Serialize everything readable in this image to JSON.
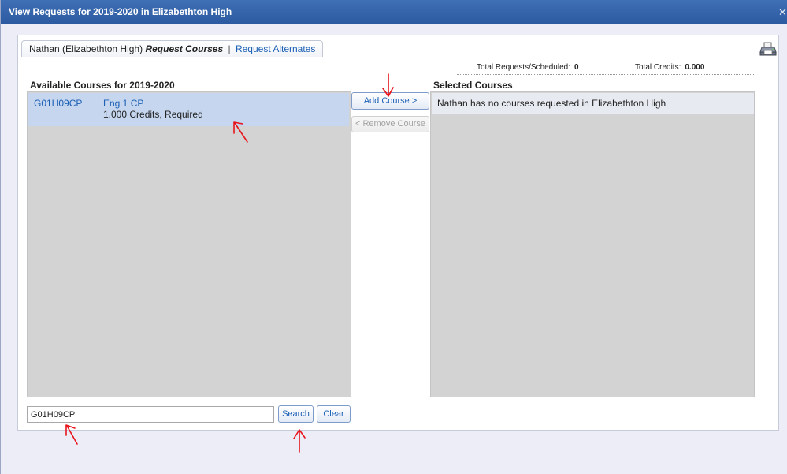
{
  "window": {
    "title": "View Requests for 2019-2020 in Elizabethton High",
    "close_glyph": "✕"
  },
  "tabs": {
    "student": "Nathan (Elizabethton High)",
    "active": "Request Courses",
    "separator": "|",
    "alternates": "Request Alternates"
  },
  "totals": {
    "requests_label": "Total Requests/Scheduled:",
    "requests_value": "0",
    "credits_label": "Total Credits:",
    "credits_value": "0.000"
  },
  "available": {
    "header": "Available Courses for 2019-2020",
    "courses": [
      {
        "code": "G01H09CP",
        "name": "Eng 1 CP",
        "meta": "1.000 Credits,  Required"
      }
    ]
  },
  "selected": {
    "header": "Selected Courses",
    "empty_message": "Nathan has no courses requested in Elizabethton High"
  },
  "actions": {
    "add_label": "Add Course >",
    "remove_label": "< Remove Course"
  },
  "search": {
    "value": "G01H09CP",
    "search_label": "Search",
    "clear_label": "Clear"
  },
  "icons": {
    "print": "printer-icon",
    "close": "close-icon"
  },
  "colors": {
    "titlebar": "#2c5aa0",
    "link": "#1a5fb4",
    "annotation": "#e8141c"
  }
}
